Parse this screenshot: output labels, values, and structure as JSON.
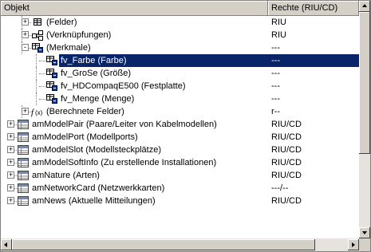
{
  "columns": {
    "object": "Objekt",
    "rights": "Rechte (RIU/CD)"
  },
  "rows": [
    {
      "label": "(Felder)",
      "rights": "RIU",
      "icon": "fields-icon",
      "level": 1,
      "expander": "+"
    },
    {
      "label": "(Verknüpfungen)",
      "rights": "RIU",
      "icon": "links-icon",
      "level": 1,
      "expander": "+"
    },
    {
      "label": "(Merkmale)",
      "rights": "---",
      "icon": "features-icon",
      "level": 1,
      "expander": "-"
    },
    {
      "label": "fv_Farbe (Farbe)",
      "rights": "---",
      "icon": "feature-value-icon",
      "level": 2,
      "selected": true
    },
    {
      "label": "fv_GroSe (Größe)",
      "rights": "---",
      "icon": "feature-value-icon",
      "level": 2
    },
    {
      "label": "fv_HDCompaqE500 (Festplatte)",
      "rights": "---",
      "icon": "feature-value-icon",
      "level": 2
    },
    {
      "label": "fv_Menge (Menge)",
      "rights": "---",
      "icon": "feature-value-icon",
      "level": 2
    },
    {
      "label": "(Berechnete Felder)",
      "rights": "r--",
      "icon": "calculated-fields-icon",
      "level": 1,
      "expander": "+"
    },
    {
      "label": "amModelPair (Paare/Leiter von Kabelmodellen)",
      "rights": "RIU/CD",
      "icon": "table-icon",
      "level": 0,
      "expander": "+"
    },
    {
      "label": "amModelPort (Modellports)",
      "rights": "RIU/CD",
      "icon": "table-icon",
      "level": 0,
      "expander": "+"
    },
    {
      "label": "amModelSlot (Modellsteckplätze)",
      "rights": "RIU/CD",
      "icon": "table-icon",
      "level": 0,
      "expander": "+"
    },
    {
      "label": "amModelSoftInfo (Zu erstellende Installationen)",
      "rights": "RIU/CD",
      "icon": "table-icon",
      "level": 0,
      "expander": "+"
    },
    {
      "label": "amNature (Arten)",
      "rights": "RIU/CD",
      "icon": "table-icon",
      "level": 0,
      "expander": "+"
    },
    {
      "label": "amNetworkCard (Netzwerkkarten)",
      "rights": "---/--",
      "icon": "table-icon",
      "level": 0,
      "expander": "+"
    },
    {
      "label": "amNews (Aktuelle Mitteilungen)",
      "rights": "RIU/CD",
      "icon": "table-icon",
      "level": 0,
      "expander": "+"
    }
  ],
  "colors": {
    "selection": "#0a246a",
    "header": "#d4d0c8"
  }
}
